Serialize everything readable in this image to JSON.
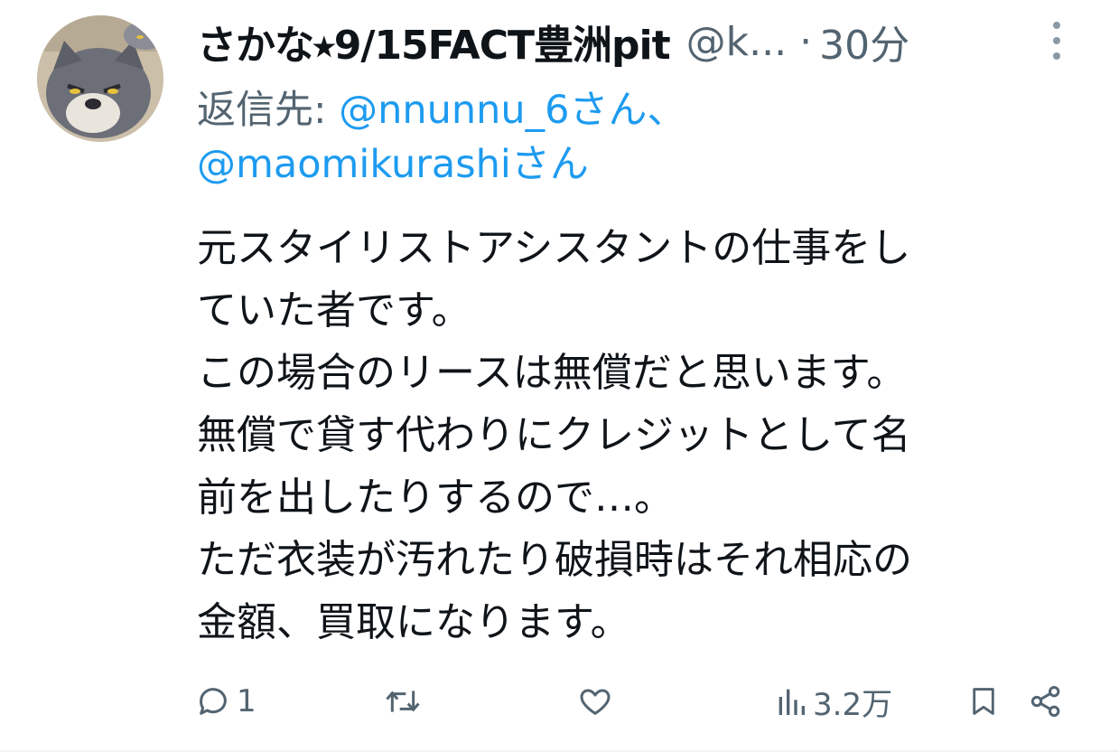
{
  "tweet": {
    "display_name": "さかな⭑9/15FACT豊洲pit",
    "handle": "@k...",
    "separator": "·",
    "time": "30分",
    "reply_prefix": "返信先: ",
    "mentions": [
      "@nnunnu_6さん、",
      "@maomikurashiさん"
    ],
    "body_lines": [
      "元スタイリストアシスタントの仕事をし",
      "ていた者です。",
      "この場合のリースは無償だと思います。",
      "無償で貸す代わりにクレジットとして名",
      "前を出したりするので…。",
      "ただ衣装が汚れたり破損時はそれ相応の",
      "金額、買取になります。"
    ]
  },
  "actions": {
    "reply_count": "1",
    "retweet_count": "",
    "like_count": "",
    "views_count": "3.2万"
  },
  "icons": {
    "more": "more-vertical-icon",
    "reply": "reply-icon",
    "retweet": "retweet-icon",
    "like": "heart-icon",
    "views": "views-icon",
    "bookmark": "bookmark-icon",
    "share": "share-icon"
  },
  "colors": {
    "text": "#0f1419",
    "secondary": "#536471",
    "link": "#1d9bf0"
  }
}
